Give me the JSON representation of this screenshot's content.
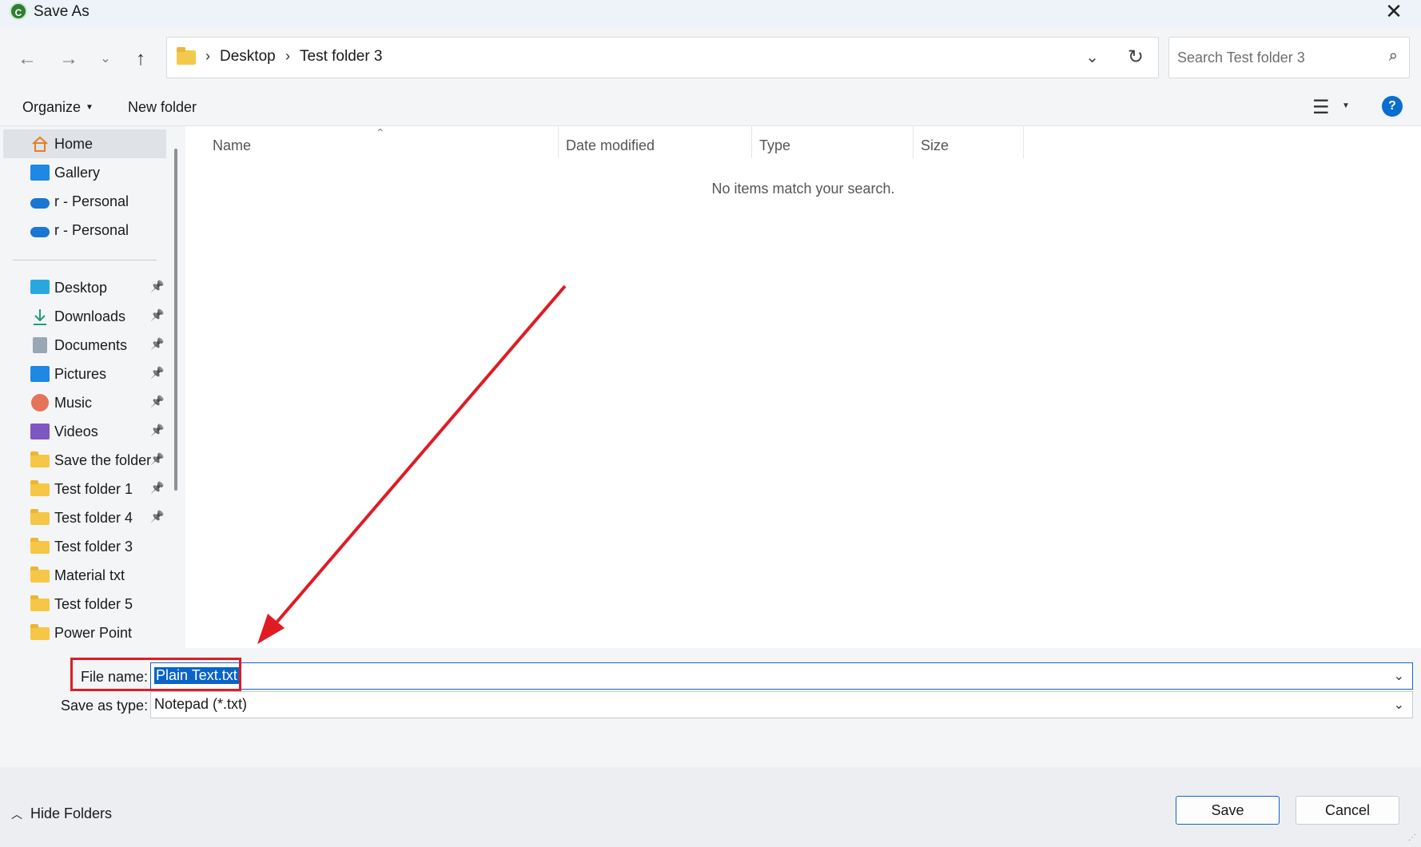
{
  "window": {
    "title": "Save As",
    "app_icon": "C"
  },
  "nav": {
    "breadcrumbs": [
      "Desktop",
      "Test folder 3"
    ],
    "search_placeholder": "Search Test folder 3"
  },
  "toolbar": {
    "organize": "Organize",
    "new_folder": "New folder"
  },
  "sidebar": {
    "top_items": [
      {
        "label": "Home",
        "icon": "home-icon"
      },
      {
        "label": "Gallery",
        "icon": "gallery-icon"
      },
      {
        "label": "r - Personal",
        "icon": "onedrive-icon"
      },
      {
        "label": "r - Personal",
        "icon": "onedrive-icon"
      }
    ],
    "quick_items": [
      {
        "label": "Desktop",
        "icon": "desktop-icon",
        "pinned": true
      },
      {
        "label": "Downloads",
        "icon": "download-icon",
        "pinned": true
      },
      {
        "label": "Documents",
        "icon": "documents-icon",
        "pinned": true
      },
      {
        "label": "Pictures",
        "icon": "pictures-icon",
        "pinned": true
      },
      {
        "label": "Music",
        "icon": "music-icon",
        "pinned": true
      },
      {
        "label": "Videos",
        "icon": "videos-icon",
        "pinned": true
      },
      {
        "label": "Save the folder",
        "icon": "folder-icon",
        "pinned": true
      },
      {
        "label": "Test folder 1",
        "icon": "folder-icon",
        "pinned": true
      },
      {
        "label": "Test folder 4",
        "icon": "folder-icon",
        "pinned": true
      },
      {
        "label": "Test folder 3",
        "icon": "folder-icon",
        "pinned": false
      },
      {
        "label": "Material txt",
        "icon": "folder-icon",
        "pinned": false
      },
      {
        "label": "Test folder 5",
        "icon": "folder-icon",
        "pinned": false
      },
      {
        "label": "Power Point",
        "icon": "folder-icon",
        "pinned": false
      }
    ]
  },
  "columns": [
    "Name",
    "Date modified",
    "Type",
    "Size"
  ],
  "empty_message": "No items match your search.",
  "form": {
    "file_name_label": "File name:",
    "file_name_value": "Plain Text.txt",
    "save_type_label": "Save as type:",
    "save_type_value": "Notepad (*.txt)"
  },
  "footer": {
    "hide_folders": "Hide Folders",
    "save": "Save",
    "cancel": "Cancel"
  },
  "colors": {
    "accent": "#0a64c8",
    "annotation": "#e01b24"
  }
}
